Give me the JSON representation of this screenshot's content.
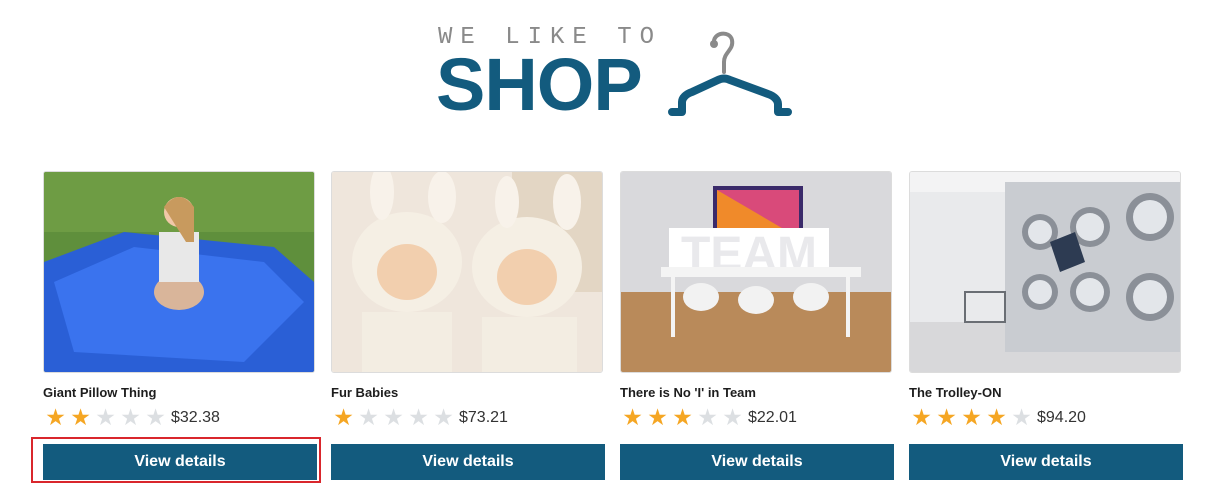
{
  "logo": {
    "tagline": "WE LIKE TO",
    "word": "SHOP",
    "icon": "hanger-icon",
    "color": "#135b7e"
  },
  "products": [
    {
      "name": "Giant Pillow Thing",
      "rating": 2,
      "max_rating": 5,
      "price": "$32.38",
      "button": "View details",
      "image": "girl on blue bean bag"
    },
    {
      "name": "Fur Babies",
      "rating": 1,
      "max_rating": 5,
      "price": "$73.21",
      "button": "View details",
      "image": "babies in bunny hats"
    },
    {
      "name": "There is No 'I' in Team",
      "rating": 3,
      "max_rating": 5,
      "price": "$22.01",
      "button": "View details",
      "image": "TEAM letters conference room"
    },
    {
      "name": "The Trolley-ON",
      "rating": 4,
      "max_rating": 5,
      "price": "$94.20",
      "button": "View details",
      "image": "laundromat jumper"
    }
  ],
  "colors": {
    "button": "#135b7e",
    "star_on": "#f5a623",
    "star_off": "#dcdfe2",
    "highlight": "#d9262c"
  }
}
